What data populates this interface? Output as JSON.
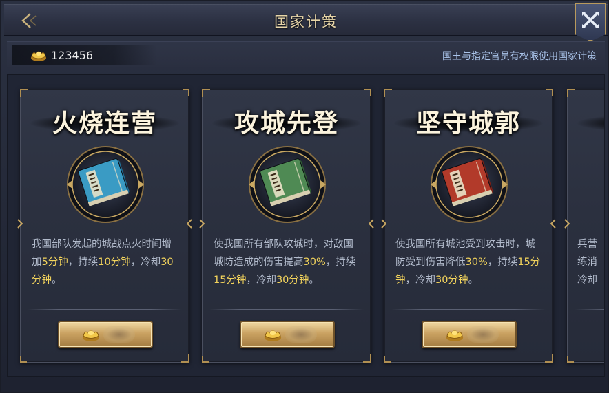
{
  "header": {
    "title": "国家计策"
  },
  "gold": {
    "amount": "123456"
  },
  "notice": "国王与指定官员有权限使用国家计策",
  "cards": [
    {
      "title": "火烧连营",
      "desc": [
        {
          "t": "我国部队发起的城战点火时间增加"
        },
        {
          "t": "5分钟",
          "hl": true
        },
        {
          "t": "，持续"
        },
        {
          "t": "10分钟",
          "hl": true
        },
        {
          "t": "，冷却"
        },
        {
          "t": "30分钟",
          "hl": true
        },
        {
          "t": "。"
        }
      ],
      "book_color": "#3a9bc4",
      "book_accent": "#1f6c92"
    },
    {
      "title": "攻城先登",
      "desc": [
        {
          "t": "使我国所有部队攻城时，对敌国城防造成的伤害提高"
        },
        {
          "t": "30%",
          "hl": true
        },
        {
          "t": "，持续"
        },
        {
          "t": "15分钟",
          "hl": true
        },
        {
          "t": "，冷却"
        },
        {
          "t": "30分钟",
          "hl": true
        },
        {
          "t": "。"
        }
      ],
      "book_color": "#4f8a54",
      "book_accent": "#2f5e34"
    },
    {
      "title": "坚守城郭",
      "desc": [
        {
          "t": "使我国所有城池受到攻击时，城防受到伤害降低"
        },
        {
          "t": "30%",
          "hl": true
        },
        {
          "t": "，持续"
        },
        {
          "t": "15分钟",
          "hl": true
        },
        {
          "t": "，冷却"
        },
        {
          "t": "30分钟",
          "hl": true
        },
        {
          "t": "。"
        }
      ],
      "book_color": "#b23a2a",
      "book_accent": "#7a1f16"
    }
  ],
  "partial_card": {
    "lines": [
      "兵营",
      "练消",
      "冷却"
    ]
  },
  "colors": {
    "highlight": "#f2d35c",
    "accent_gold": "#b08f52",
    "title": "#e8d6a8",
    "notice": "#aac4ea"
  }
}
